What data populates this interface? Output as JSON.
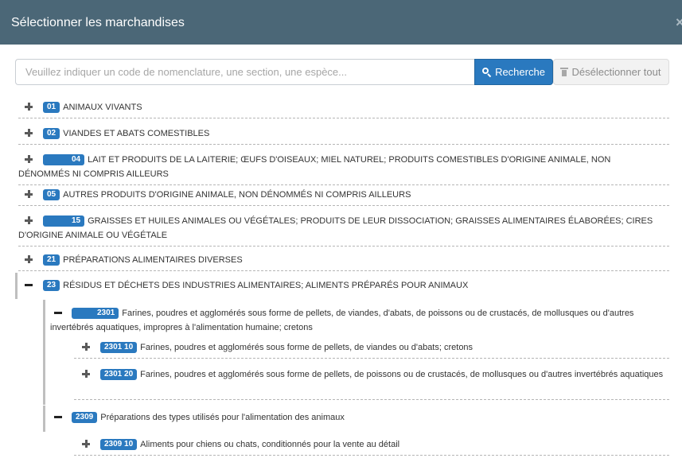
{
  "modal": {
    "title": "Sélectionner les marchandises",
    "close_label": "×"
  },
  "search": {
    "placeholder": "Veuillez indiquer un code de nomenclature, une section, une espèce...",
    "value": "",
    "button_label": "Recherche",
    "deselect_label": "Désélectionner tout"
  },
  "tree": [
    {
      "code": "01",
      "label": "ANIMAUX VIVANTS",
      "state": "collapsed",
      "level": 0
    },
    {
      "code": "02",
      "label": "VIANDES ET ABATS COMESTIBLES",
      "state": "collapsed",
      "level": 0
    },
    {
      "code": "04",
      "label": "LAIT ET PRODUITS DE LA LAITERIE; ŒUFS D'OISEAUX; MIEL NATUREL; PRODUITS COMESTIBLES D'ORIGINE ANIMALE, NON DÉNOMMÉS NI COMPRIS AILLEURS",
      "state": "collapsed",
      "level": 0
    },
    {
      "code": "05",
      "label": "AUTRES PRODUITS D'ORIGINE ANIMALE, NON DÉNOMMÉS NI COMPRIS AILLEURS",
      "state": "collapsed",
      "level": 0
    },
    {
      "code": "15",
      "label": "GRAISSES ET HUILES ANIMALES OU VÉGÉTALES; PRODUITS DE LEUR DISSOCIATION; GRAISSES ALIMENTAIRES ÉLABORÉES; CIRES D'ORIGINE ANIMALE OU VÉGÉTALE",
      "state": "collapsed",
      "level": 0
    },
    {
      "code": "21",
      "label": "PRÉPARATIONS ALIMENTAIRES DIVERSES",
      "state": "collapsed",
      "level": 0
    },
    {
      "code": "23",
      "label": "RÉSIDUS ET DÉCHETS DES INDUSTRIES ALIMENTAIRES; ALIMENTS PRÉPARÉS POUR ANIMAUX",
      "state": "expanded",
      "level": 0
    },
    {
      "code": "2301",
      "label": "Farines, poudres et agglomérés sous forme de pellets, de viandes, d'abats, de poissons ou de crustacés, de mollusques ou d'autres invertébrés aquatiques, impropres à l'alimentation humaine; cretons",
      "state": "expanded",
      "level": 1
    },
    {
      "code": "2301 10",
      "label": "Farines, poudres et agglomérés sous forme de pellets, de viandes ou d'abats; cretons",
      "state": "collapsed",
      "level": 2
    },
    {
      "code": "2301 20",
      "label": "Farines, poudres et agglomérés sous forme de pellets, de poissons ou de crustacés, de mollusques ou d'autres invertébrés aquatiques",
      "state": "collapsed",
      "level": 2
    },
    {
      "code": "2309",
      "label": "Préparations des types utilisés pour l'alimentation des animaux",
      "state": "expanded",
      "level": 1
    },
    {
      "code": "2309 10",
      "label": "Aliments pour chiens ou chats, conditionnés pour la vente au détail",
      "state": "collapsed",
      "level": 2
    }
  ],
  "colors": {
    "header_bg": "#4b6777",
    "badge_bg": "#2a79bf",
    "search_button_bg": "#2a79bf",
    "deselect_button_bg": "#f2f2f2"
  }
}
